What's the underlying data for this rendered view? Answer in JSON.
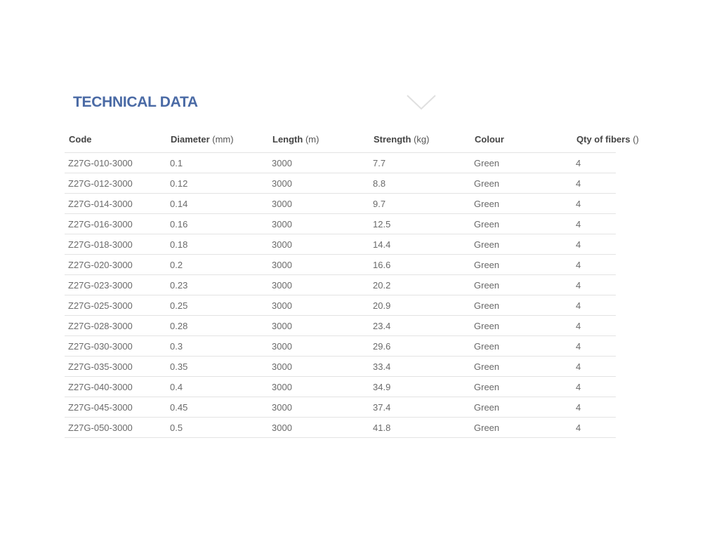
{
  "section": {
    "title": "TECHNICAL DATA",
    "toggle_icon": "chevron-down-icon"
  },
  "table": {
    "columns": [
      {
        "label": "Code",
        "unit": ""
      },
      {
        "label": "Diameter",
        "unit": "(mm)"
      },
      {
        "label": "Length",
        "unit": "(m)"
      },
      {
        "label": "Strength",
        "unit": "(kg)"
      },
      {
        "label": "Colour",
        "unit": ""
      },
      {
        "label": "Qty of fibers",
        "unit": "()"
      }
    ],
    "rows": [
      [
        "Z27G-010-3000",
        "0.1",
        "3000",
        "7.7",
        "Green",
        "4"
      ],
      [
        "Z27G-012-3000",
        "0.12",
        "3000",
        "8.8",
        "Green",
        "4"
      ],
      [
        "Z27G-014-3000",
        "0.14",
        "3000",
        "9.7",
        "Green",
        "4"
      ],
      [
        "Z27G-016-3000",
        "0.16",
        "3000",
        "12.5",
        "Green",
        "4"
      ],
      [
        "Z27G-018-3000",
        "0.18",
        "3000",
        "14.4",
        "Green",
        "4"
      ],
      [
        "Z27G-020-3000",
        "0.2",
        "3000",
        "16.6",
        "Green",
        "4"
      ],
      [
        "Z27G-023-3000",
        "0.23",
        "3000",
        "20.2",
        "Green",
        "4"
      ],
      [
        "Z27G-025-3000",
        "0.25",
        "3000",
        "20.9",
        "Green",
        "4"
      ],
      [
        "Z27G-028-3000",
        "0.28",
        "3000",
        "23.4",
        "Green",
        "4"
      ],
      [
        "Z27G-030-3000",
        "0.3",
        "3000",
        "29.6",
        "Green",
        "4"
      ],
      [
        "Z27G-035-3000",
        "0.35",
        "3000",
        "33.4",
        "Green",
        "4"
      ],
      [
        "Z27G-040-3000",
        "0.4",
        "3000",
        "34.9",
        "Green",
        "4"
      ],
      [
        "Z27G-045-3000",
        "0.45",
        "3000",
        "37.4",
        "Green",
        "4"
      ],
      [
        "Z27G-050-3000",
        "0.5",
        "3000",
        "41.8",
        "Green",
        "4"
      ]
    ]
  },
  "colors": {
    "title": "#4a6aa5",
    "header_text": "#444444",
    "cell_text": "#6a6a6a",
    "row_divider": "#e3e3e3",
    "chevron": "#e0e0e0"
  }
}
